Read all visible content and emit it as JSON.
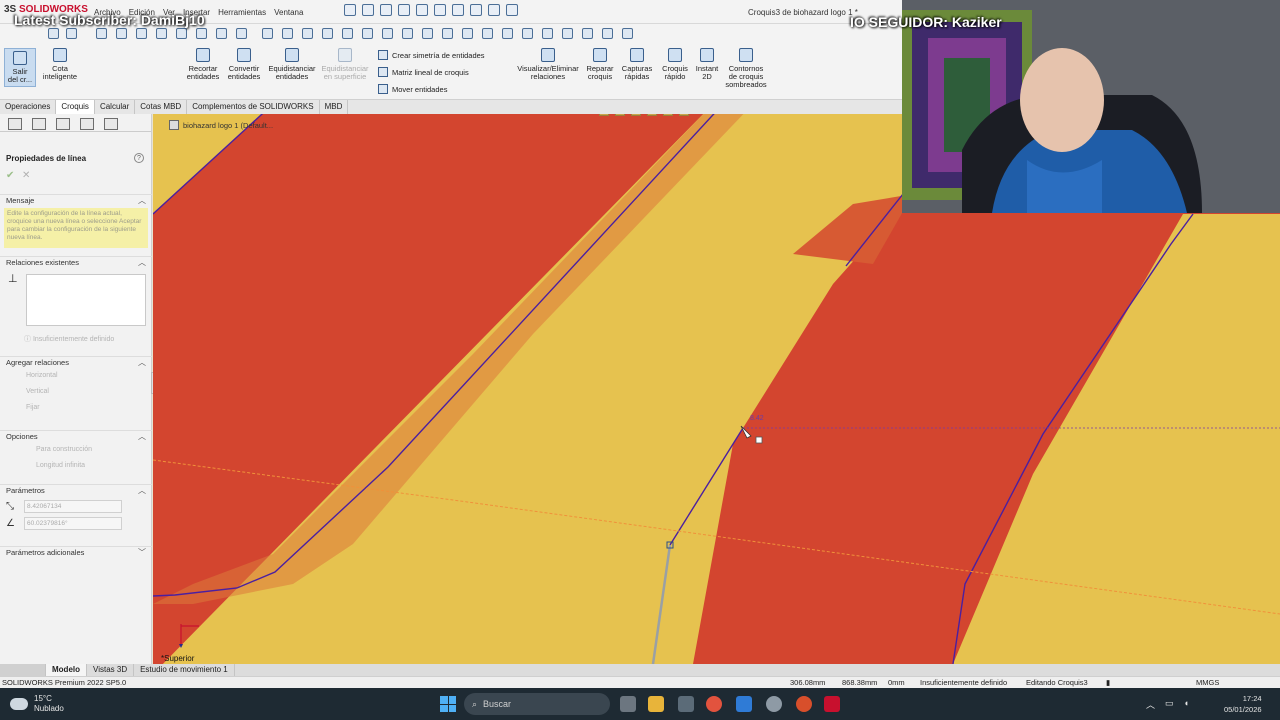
{
  "app": {
    "logo_prefix": "3S",
    "logo_name": "SOLIDWORKS",
    "doc_title": "Croquis3 de biohazard logo 1 *"
  },
  "overlays": {
    "subscriber": "Latest Subscriber: DamiBj10",
    "follower": "IO SEGUIDOR: Kaziker"
  },
  "menu": [
    "Archivo",
    "Edición",
    "Ver",
    "Insertar",
    "Herramientas",
    "Ventana"
  ],
  "commands": {
    "salir": "Salir del cr...",
    "cota": "Cota inteligente",
    "recortar": "Recortar entidades",
    "convertir": "Convertir entidades",
    "equidistanciar": "Equidistanciar entidades",
    "equid_superficie": "Equidistanciar en superficie",
    "simetria": "Crear simetría de entidades",
    "matriz": "Matriz lineal de croquis",
    "mover": "Mover entidades",
    "visualizar": "Visualizar/Eliminar relaciones",
    "reparar": "Reparar croquis",
    "capturas": "Capturas rápidas",
    "croquis_rapido": "Croquis rápido",
    "instant2d": "Instant 2D",
    "contornos": "Contornos de croquis sombreados"
  },
  "tabs": [
    {
      "label": "Operaciones",
      "active": false
    },
    {
      "label": "Croquis",
      "active": true
    },
    {
      "label": "Calcular",
      "active": false
    },
    {
      "label": "Cotas MBD",
      "active": false
    },
    {
      "label": "Complementos de SOLIDWORKS",
      "active": false
    },
    {
      "label": "MBD",
      "active": false
    }
  ],
  "panel": {
    "title": "Propiedades de línea",
    "help": "?",
    "mensaje_header": "Mensaje",
    "mensaje_text": "Edite la configuración de la línea actual, croquice una nueva línea o seleccione Aceptar para cambiar la configuración de la siguiente nueva línea.",
    "relaciones_header": "Relaciones existentes",
    "estado": "Insuficientemente definido",
    "agregar_header": "Agregar relaciones",
    "horizontal": "Horizontal",
    "vertical": "Vertical",
    "fijar": "Fijar",
    "opciones_header": "Opciones",
    "construccion": "Para construcción",
    "longitud_infinita": "Longitud infinita",
    "parametros_header": "Parámetros",
    "length_value": "8.42067134",
    "angle_value": "60.02379816°",
    "adicionales_header": "Parámetros adicionales"
  },
  "graphics": {
    "tree_node": "biohazard logo 1 (Default...",
    "dimension": "8.42",
    "view": "*Superior"
  },
  "bottom_tabs": [
    {
      "label": "Modelo",
      "active": true
    },
    {
      "label": "Vistas 3D",
      "active": false
    },
    {
      "label": "Estudio de movimiento 1",
      "active": false
    }
  ],
  "status": {
    "product": "SOLIDWORKS Premium 2022 SP5.0",
    "x": "306.08mm",
    "y": "868.38mm",
    "z": "0mm",
    "state": "Insuficientemente definido",
    "editing": "Editando Croquis3",
    "units": "MMGS"
  },
  "taskbar": {
    "temp": "15°C",
    "weather": "Nublado",
    "search": "Buscar",
    "time": "17:24",
    "date": "05/01/2026"
  },
  "colors": {
    "accent": "#c8102e",
    "sketch_line": "#4b1fa0",
    "red_fill": "#d2452f",
    "yellow_fill": "#e4c24e"
  }
}
